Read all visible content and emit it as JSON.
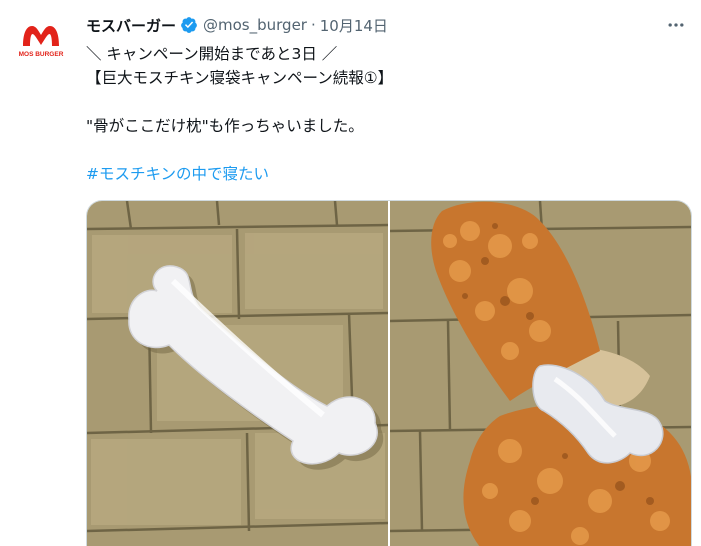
{
  "account": {
    "display_name": "モスバーガー",
    "handle": "@mos_burger",
    "separator": "·",
    "date": "10月14日",
    "avatar_logo_text": "MOS BURGER"
  },
  "tweet": {
    "line1": "＼ キャンペーン開始まであと3日 ／",
    "line2": "【巨大モスチキン寝袋キャンペーン続報①】",
    "line3": "\"骨がここだけ枕\"も作っちゃいました。",
    "hashtag": "#モスチキンの中で寝たい"
  },
  "colors": {
    "brand_red": "#e2231a",
    "verified_blue": "#1d9bf0",
    "hashtag_blue": "#1d9bf0",
    "muted_text": "#536471"
  },
  "icons": {
    "verified": "verified-badge-icon",
    "more": "more-options-icon"
  }
}
